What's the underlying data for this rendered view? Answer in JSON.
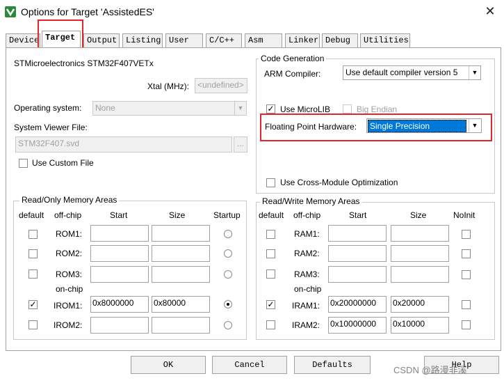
{
  "window": {
    "title": "Options for Target 'AssistedES'",
    "close_glyph": "✕"
  },
  "tabs": [
    "Device",
    "Target",
    "Output",
    "Listing",
    "User",
    "C/C++",
    "Asm",
    "Linker",
    "Debug",
    "Utilities"
  ],
  "device_name": "STMicroelectronics STM32F407VETx",
  "xtal": {
    "label": "Xtal (MHz):",
    "value": "<undefined>"
  },
  "os": {
    "label": "Operating system:",
    "value": "None"
  },
  "svd": {
    "label": "System Viewer File:",
    "value": "STM32F407.svd",
    "browse": "..."
  },
  "custom_file": {
    "label": "Use Custom File",
    "checked": false
  },
  "code_gen": {
    "title": "Code Generation",
    "compiler_label": "ARM Compiler:",
    "compiler_value": "Use default compiler version 5",
    "microlib_label": "Use MicroLIB",
    "microlib_checked": true,
    "big_endian_label": "Big Endian",
    "fp_label": "Floating Point Hardware:",
    "fp_value": "Single Precision",
    "cross_module_label": "Use Cross-Module Optimization"
  },
  "ro_memory": {
    "title": "Read/Only Memory Areas",
    "headers": {
      "default": "default",
      "offchip": "off-chip",
      "start": "Start",
      "size": "Size",
      "extra": "Startup"
    },
    "onchip_label": "on-chip",
    "rows": [
      {
        "name": "ROM1:",
        "start": "",
        "size": "",
        "default": false,
        "selected": false
      },
      {
        "name": "ROM2:",
        "start": "",
        "size": "",
        "default": false,
        "selected": false
      },
      {
        "name": "ROM3:",
        "start": "",
        "size": "",
        "default": false,
        "selected": false
      },
      {
        "name": "IROM1:",
        "start": "0x8000000",
        "size": "0x80000",
        "default": true,
        "selected": true
      },
      {
        "name": "IROM2:",
        "start": "",
        "size": "",
        "default": false,
        "selected": false
      }
    ]
  },
  "rw_memory": {
    "title": "Read/Write Memory Areas",
    "headers": {
      "default": "default",
      "offchip": "off-chip",
      "start": "Start",
      "size": "Size",
      "extra": "NoInit"
    },
    "onchip_label": "on-chip",
    "rows": [
      {
        "name": "RAM1:",
        "start": "",
        "size": "",
        "default": false,
        "noinit": false
      },
      {
        "name": "RAM2:",
        "start": "",
        "size": "",
        "default": false,
        "noinit": false
      },
      {
        "name": "RAM3:",
        "start": "",
        "size": "",
        "default": false,
        "noinit": false
      },
      {
        "name": "IRAM1:",
        "start": "0x20000000",
        "size": "0x20000",
        "default": true,
        "noinit": false
      },
      {
        "name": "IRAM2:",
        "start": "0x10000000",
        "size": "0x10000",
        "default": false,
        "noinit": false
      }
    ]
  },
  "buttons": {
    "ok": "OK",
    "cancel": "Cancel",
    "defaults": "Defaults",
    "help": "Help"
  },
  "watermark": "CSDN @路漫非溪",
  "colors": {
    "highlight": "#e3262b",
    "selection": "#0078d7"
  }
}
